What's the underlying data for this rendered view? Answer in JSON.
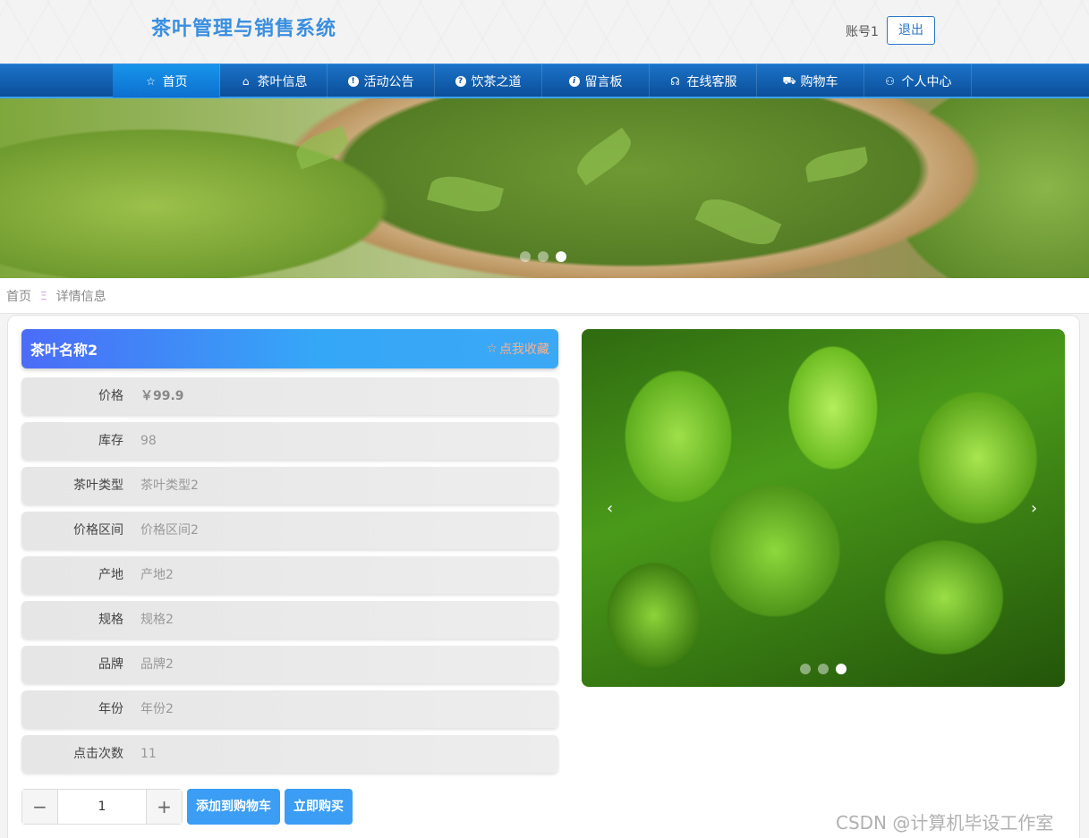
{
  "header": {
    "title": "茶叶管理与销售系统",
    "account": "账号1",
    "logout_label": "退出"
  },
  "nav": {
    "items": [
      {
        "label": "首页",
        "icon": "star-icon",
        "glyph": "☆"
      },
      {
        "label": "茶叶信息",
        "icon": "bag-icon",
        "glyph": "⌂"
      },
      {
        "label": "活动公告",
        "icon": "alert-icon",
        "glyph": "!"
      },
      {
        "label": "饮茶之道",
        "icon": "question-icon",
        "glyph": "?"
      },
      {
        "label": "留言板",
        "icon": "info-icon",
        "glyph": "i"
      },
      {
        "label": "在线客服",
        "icon": "headset-icon",
        "glyph": "☊"
      },
      {
        "label": "购物车",
        "icon": "cart-icon",
        "glyph": "⛟"
      },
      {
        "label": "个人中心",
        "icon": "user-icon",
        "glyph": "⚇"
      }
    ]
  },
  "breadcrumb": {
    "home": "首页",
    "separator": "Ξ",
    "current": "详情信息"
  },
  "product": {
    "name": "茶叶名称2",
    "favorite_label": "点我收藏",
    "fields": [
      {
        "label": "价格",
        "value": "￥99.9"
      },
      {
        "label": "库存",
        "value": "98"
      },
      {
        "label": "茶叶类型",
        "value": "茶叶类型2"
      },
      {
        "label": "价格区间",
        "value": "价格区间2"
      },
      {
        "label": "产地",
        "value": "产地2"
      },
      {
        "label": "规格",
        "value": "规格2"
      },
      {
        "label": "品牌",
        "value": "品牌2"
      },
      {
        "label": "年份",
        "value": "年份2"
      },
      {
        "label": "点击次数",
        "value": "11"
      }
    ],
    "quantity": "1",
    "add_to_cart_label": "添加到购物车",
    "buy_now_label": "立即购买"
  },
  "carousel": {
    "prev": "‹",
    "next": "›"
  },
  "watermark": "CSDN @计算机毕设工作室",
  "colors": {
    "brand": "#3a8fe0",
    "nav_bg": "#0b4f9a",
    "button": "#3b9df4",
    "title_gradient_start": "#4b6cf7",
    "title_gradient_end": "#35a7f7"
  }
}
